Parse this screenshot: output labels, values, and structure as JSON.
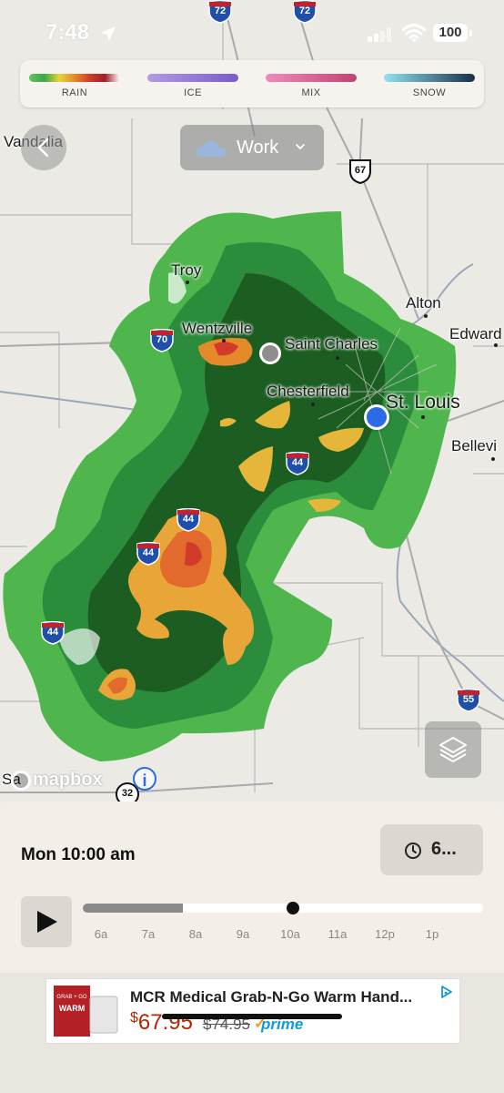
{
  "status_bar": {
    "time": "7:48",
    "battery": "100"
  },
  "legend": [
    {
      "label": "RAIN",
      "gradient": "linear-gradient(90deg,#63c45a,#3aa84a,#e6d43c,#e48a2c,#d23b2a,#9e1f2a,#fff)"
    },
    {
      "label": "ICE",
      "gradient": "linear-gradient(90deg,#b49ae6,#7a5bc8)"
    },
    {
      "label": "MIX",
      "gradient": "linear-gradient(90deg,#ee8bbb,#c04472)"
    },
    {
      "label": "SNOW",
      "gradient": "linear-gradient(90deg,#8fe3ef,#1b2f4a)"
    }
  ],
  "location_selector": {
    "label": "Work"
  },
  "map": {
    "cities": {
      "vandalia": "Vandalia",
      "troy": "Troy",
      "alton": "Alton",
      "edwardsville": "Edward",
      "wentzville": "Wentzville",
      "saint_charles": "Saint Charles",
      "chesterfield": "Chesterfield",
      "st_louis": "St. Louis",
      "belleville": "Bellevi",
      "salem": "Sa"
    },
    "routes": {
      "i72_left": "72",
      "i72_right": "72",
      "us67": "67",
      "i70": "70",
      "i44_a": "44",
      "i44_b": "44",
      "i44_c": "44",
      "i44_d": "44",
      "i55": "55",
      "r32": "32"
    },
    "attribution": "mapbox"
  },
  "timeline": {
    "current_time": "Mon 10:00 am",
    "speed_label": "6...",
    "progress": 0.525,
    "played_fraction": 0.25,
    "ticks": [
      "6a",
      "7a",
      "8a",
      "9a",
      "10a",
      "11a",
      "12p",
      "1p"
    ]
  },
  "ad": {
    "title": "MCR Medical Grab-N-Go Warm Hand...",
    "price_currency": "$",
    "price": "67.95",
    "old_price": "$74.95",
    "prime": "prime",
    "image_text_1": "GRAB + GO",
    "image_text_2": "WARM"
  }
}
